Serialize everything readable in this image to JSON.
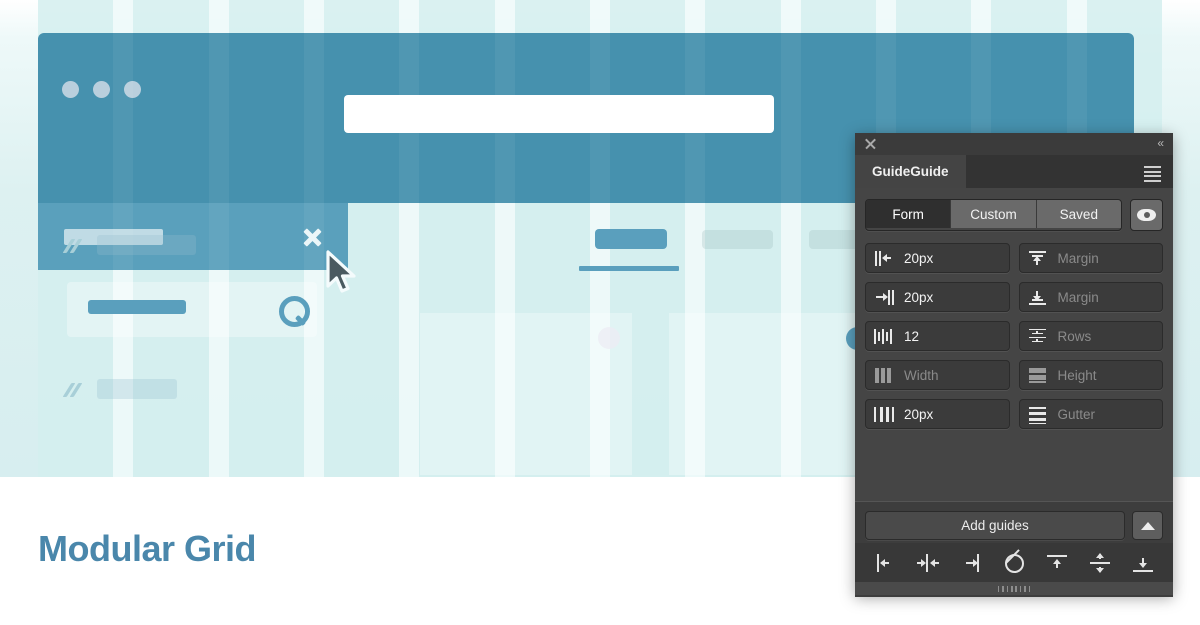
{
  "page": {
    "title": "Modular Grid",
    "accent_blue": "#4691ae",
    "grid_tint": "#d4eeee",
    "gutter_tint": "#eefafa"
  },
  "mockup": {
    "window_dots": [
      "dot-1",
      "dot-2",
      "dot-3"
    ],
    "search_field_placeholder": "",
    "close_icon": "close-x-icon",
    "cursor_icon": "mouse-pointer-icon",
    "search_icon": "magnifier-icon",
    "disclosure_icon": "chevron-right-icon"
  },
  "panel": {
    "titlebar": {
      "close_icon": "close-icon",
      "collapse_label": "«",
      "collapse_icon": "collapse-panel-icon"
    },
    "tab_title": "GuideGuide",
    "menu_icon": "hamburger-menu-icon",
    "segmented": {
      "options": [
        "Form",
        "Custom",
        "Saved"
      ],
      "active": "Form"
    },
    "preview_toggle": {
      "icon": "eye-icon",
      "label": ""
    },
    "fields": [
      {
        "icon": "left-margin-icon",
        "value": "20px",
        "empty": false,
        "col": "left"
      },
      {
        "icon": "top-margin-icon",
        "value": "Margin",
        "empty": true,
        "col": "right"
      },
      {
        "icon": "right-margin-icon",
        "value": "20px",
        "empty": false,
        "col": "left"
      },
      {
        "icon": "bottom-margin-icon",
        "value": "Margin",
        "empty": true,
        "col": "right"
      },
      {
        "icon": "columns-count-icon",
        "value": "12",
        "empty": false,
        "col": "left"
      },
      {
        "icon": "rows-count-icon",
        "value": "Rows",
        "empty": true,
        "col": "right"
      },
      {
        "icon": "column-width-icon",
        "value": "Width",
        "empty": true,
        "col": "left"
      },
      {
        "icon": "row-height-icon",
        "value": "Height",
        "empty": true,
        "col": "right"
      },
      {
        "icon": "column-gutter-icon",
        "value": "20px",
        "empty": false,
        "col": "left"
      },
      {
        "icon": "row-gutter-icon",
        "value": "Gutter",
        "empty": true,
        "col": "right"
      }
    ],
    "footer": {
      "add_guides_label": "Add guides",
      "expand_icon": "triangle-up-icon"
    },
    "toolbar_icons": [
      "align-left-edge-icon",
      "align-horizontal-center-icon",
      "align-right-edge-icon",
      "clear-guides-icon",
      "align-top-edge-icon",
      "align-vertical-center-icon",
      "align-bottom-edge-icon"
    ],
    "resize_grip_icon": "resize-grip-icon"
  },
  "chart_data": {
    "type": "table",
    "title": "GuideGuide grid parameters",
    "categories": [
      "Left margin",
      "Top margin",
      "Right margin",
      "Bottom margin",
      "Columns",
      "Rows",
      "Column width",
      "Row height",
      "Column gutter",
      "Row gutter"
    ],
    "values": [
      "20px",
      "",
      "20px",
      "",
      "12",
      "",
      "",
      "",
      "20px",
      ""
    ]
  }
}
